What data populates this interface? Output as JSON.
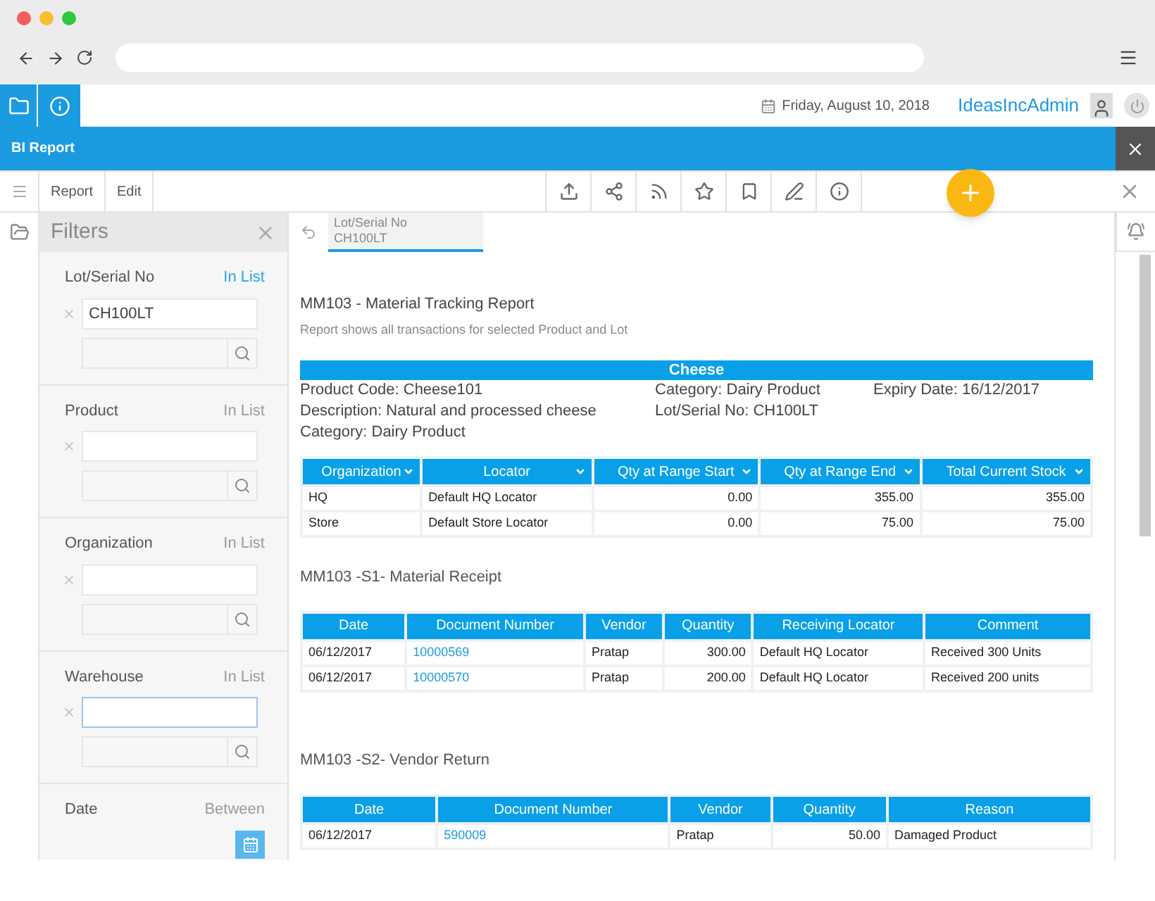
{
  "app": {
    "date": "Friday, August 10, 2018",
    "user": "IdeasIncAdmin"
  },
  "title": "BI Report",
  "menu": [
    "Report",
    "Edit"
  ],
  "filters": {
    "title": "Filters",
    "items": [
      {
        "label": "Lot/Serial No",
        "mode": "In List",
        "active": true,
        "kind": "list",
        "value": "CH100LT",
        "focused": false
      },
      {
        "label": "Product",
        "mode": "In List",
        "active": false,
        "kind": "list",
        "value": "",
        "focused": false
      },
      {
        "label": "Organization",
        "mode": "In List",
        "active": false,
        "kind": "list",
        "value": "",
        "focused": false
      },
      {
        "label": "Warehouse",
        "mode": "In List",
        "active": false,
        "kind": "list",
        "value": "",
        "focused": true
      },
      {
        "label": "Date",
        "mode": "Between",
        "active": false,
        "kind": "date"
      }
    ]
  },
  "chip": {
    "label": "Lot/Serial No",
    "value": "CH100LT"
  },
  "report": {
    "title": "MM103 - Material Tracking Report",
    "subtitle": "Report shows all transactions for selected Product and Lot",
    "product": {
      "name": "Cheese",
      "columns": [
        [
          "Product Code: Cheese101",
          "Description: Natural and processed cheese",
          "Category: Dairy Product"
        ],
        [
          "Category: Dairy Product",
          "Lot/Serial No: CH100LT"
        ],
        [
          "Expiry Date: 16/12/2017"
        ]
      ]
    },
    "sections": [
      {
        "header_menus": true,
        "columns": [
          {
            "label": "Organization",
            "kind": "text"
          },
          {
            "label": "Locator",
            "kind": "text"
          },
          {
            "label": "Qty at Range Start",
            "kind": "number"
          },
          {
            "label": "Qty at Range End",
            "kind": "number"
          },
          {
            "label": "Total Current Stock",
            "kind": "number"
          }
        ],
        "rows": [
          [
            "HQ",
            "Default HQ Locator",
            "0.00",
            "355.00",
            "355.00"
          ],
          [
            "Store",
            "Default Store Locator",
            "0.00",
            "75.00",
            "75.00"
          ]
        ]
      },
      {
        "title": "MM103 -S1- Material Receipt",
        "header_menus": false,
        "columns": [
          {
            "label": "Date",
            "kind": "text"
          },
          {
            "label": "Document Number",
            "kind": "link"
          },
          {
            "label": "Vendor",
            "kind": "text"
          },
          {
            "label": "Quantity",
            "kind": "number"
          },
          {
            "label": "Receiving Locator",
            "kind": "text"
          },
          {
            "label": "Comment",
            "kind": "text"
          }
        ],
        "rows": [
          [
            "06/12/2017",
            "10000569",
            "Pratap",
            "300.00",
            "Default HQ Locator",
            "Received 300 Units"
          ],
          [
            "06/12/2017",
            "10000570",
            "Pratap",
            "200.00",
            "Default HQ Locator",
            "Received 200 units"
          ]
        ]
      },
      {
        "title": "MM103 -S2- Vendor Return",
        "header_menus": false,
        "columns": [
          {
            "label": "Date",
            "kind": "text"
          },
          {
            "label": "Document Number",
            "kind": "link"
          },
          {
            "label": "Vendor",
            "kind": "text"
          },
          {
            "label": "Quantity",
            "kind": "number"
          },
          {
            "label": "Reason",
            "kind": "text"
          }
        ],
        "rows": [
          [
            "06/12/2017",
            "590009",
            "Pratap",
            "50.00",
            "Damaged Product"
          ]
        ]
      }
    ]
  }
}
